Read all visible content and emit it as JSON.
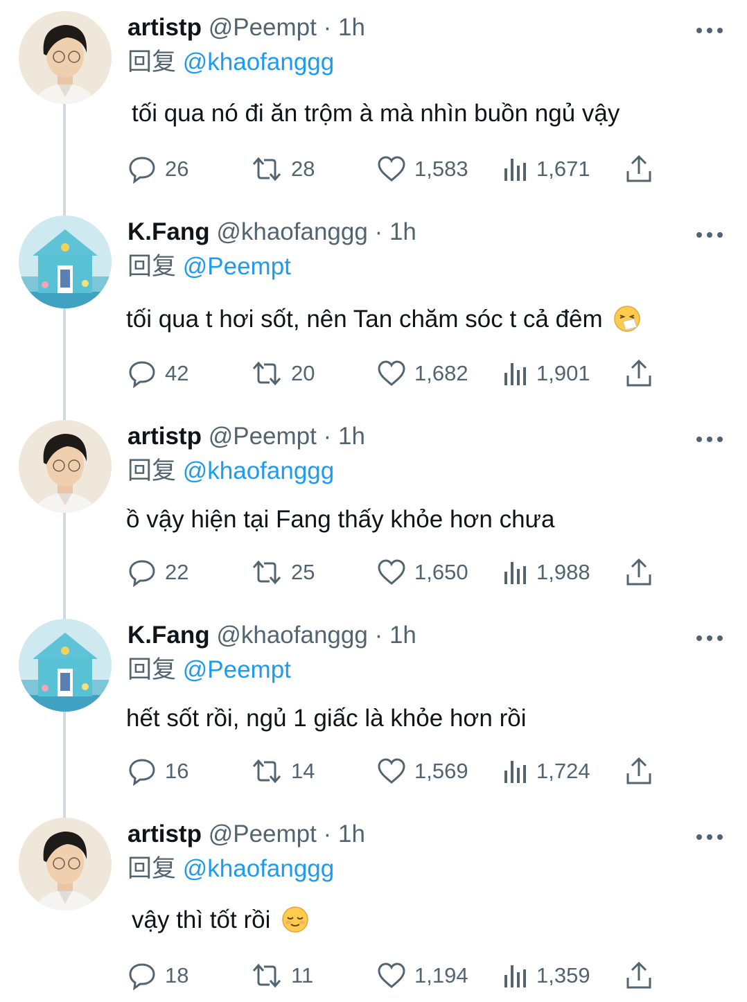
{
  "reply_prefix": "回复",
  "tweets": [
    {
      "name": "artistp",
      "handle": "@Peempt",
      "dot": "·",
      "time": "1h",
      "reply_to": "@khaofanggg",
      "text": "tối qua nó đi ăn trộm à mà nhìn buồn ngủ vậy",
      "emoji": "",
      "replies": "26",
      "retweets": "28",
      "likes": "1,583",
      "views": "1,671"
    },
    {
      "name": "K.Fang",
      "handle": "@khaofanggg",
      "dot": "·",
      "time": "1h",
      "reply_to": "@Peempt",
      "text": "tối qua t hơi sốt, nên Tan chăm sóc t cả đêm",
      "emoji": "sneezing-face",
      "replies": "42",
      "retweets": "20",
      "likes": "1,682",
      "views": "1,901"
    },
    {
      "name": "artistp",
      "handle": "@Peempt",
      "dot": "·",
      "time": "1h",
      "reply_to": "@khaofanggg",
      "text": "ồ vậy hiện tại Fang thấy khỏe hơn chưa",
      "emoji": "",
      "replies": "22",
      "retweets": "25",
      "likes": "1,650",
      "views": "1,988"
    },
    {
      "name": "K.Fang",
      "handle": "@khaofanggg",
      "dot": "·",
      "time": "1h",
      "reply_to": "@Peempt",
      "text": "hết sốt rồi, ngủ 1 giấc là khỏe hơn rồi",
      "emoji": "",
      "replies": "16",
      "retweets": "14",
      "likes": "1,569",
      "views": "1,724"
    },
    {
      "name": "artistp",
      "handle": "@Peempt",
      "dot": "·",
      "time": "1h",
      "reply_to": "@khaofanggg",
      "text": "vậy thì tốt rồi",
      "emoji": "relieved-face",
      "replies": "18",
      "retweets": "11",
      "likes": "1,194",
      "views": "1,359"
    }
  ],
  "colors": {
    "link": "#1d9bf0",
    "muted": "#536471",
    "text": "#0f1419"
  }
}
